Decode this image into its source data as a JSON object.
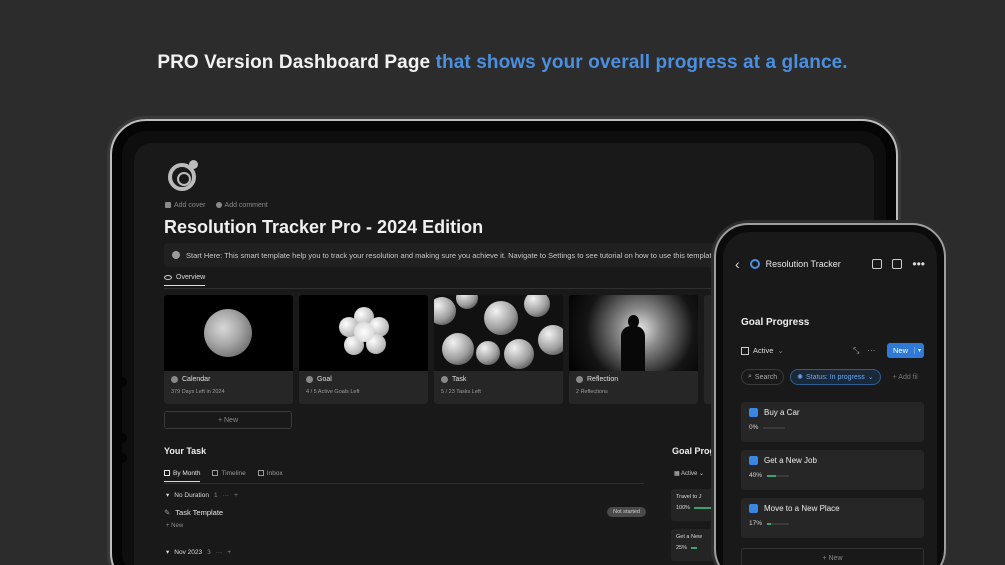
{
  "headline": {
    "white": "PRO Version Dashboard Page",
    "blue": "that shows your overall progress at a glance."
  },
  "colors": {
    "accent_blue": "#4b8fe0",
    "background": "#2c2c2c",
    "screen": "#191919",
    "progress_green": "#3fa26b"
  },
  "tablet": {
    "meta": {
      "add_cover": "Add cover",
      "add_comment": "Add comment"
    },
    "title": "Resolution Tracker Pro  - 2024 Edition",
    "callout": "Start Here: This smart template help you to track your resolution and making sure you achieve it. Navigate to Settings to see tutorial on how to use this template.",
    "tab": "Overview",
    "cards": [
      {
        "title": "Calendar",
        "subtitle": "379 Days Left in 2024"
      },
      {
        "title": "Goal",
        "subtitle": "4 / 5 Active Goals Left"
      },
      {
        "title": "Task",
        "subtitle": "5 / 23 Tasks Left"
      },
      {
        "title": "Reflection",
        "subtitle": "2 Reflections"
      }
    ],
    "new_label": "+ New",
    "your_task": {
      "heading": "Your Task",
      "views": [
        "By Month",
        "Timeline",
        "Inbox"
      ],
      "group1": {
        "label": "No Duration",
        "count": "1"
      },
      "task": {
        "name": "Task Template",
        "status": "Not started"
      },
      "sub_new": "+ New",
      "group2": {
        "label": "Nov 2023",
        "count": "3"
      }
    },
    "goal_peek": {
      "heading": "Goal Progr",
      "view": "Active",
      "items": [
        {
          "name": "Travel to J",
          "progress": "100%"
        },
        {
          "name": "Get a New",
          "progress": "25%"
        }
      ]
    }
  },
  "phone": {
    "app_title": "Resolution Tracker",
    "section_title": "Goal Progress",
    "view": "Active",
    "new_button": "New",
    "filters": {
      "search": "Search",
      "status": "Status: In progress",
      "add": "+ Add fil"
    },
    "goals": [
      {
        "name": "Buy a Car",
        "progress_label": "0%",
        "progress": 0
      },
      {
        "name": "Get a New Job",
        "progress_label": "40%",
        "progress": 0.4
      },
      {
        "name": "Move to a New Place",
        "progress_label": "17%",
        "progress": 0.17
      }
    ],
    "new_label": "+ New"
  }
}
